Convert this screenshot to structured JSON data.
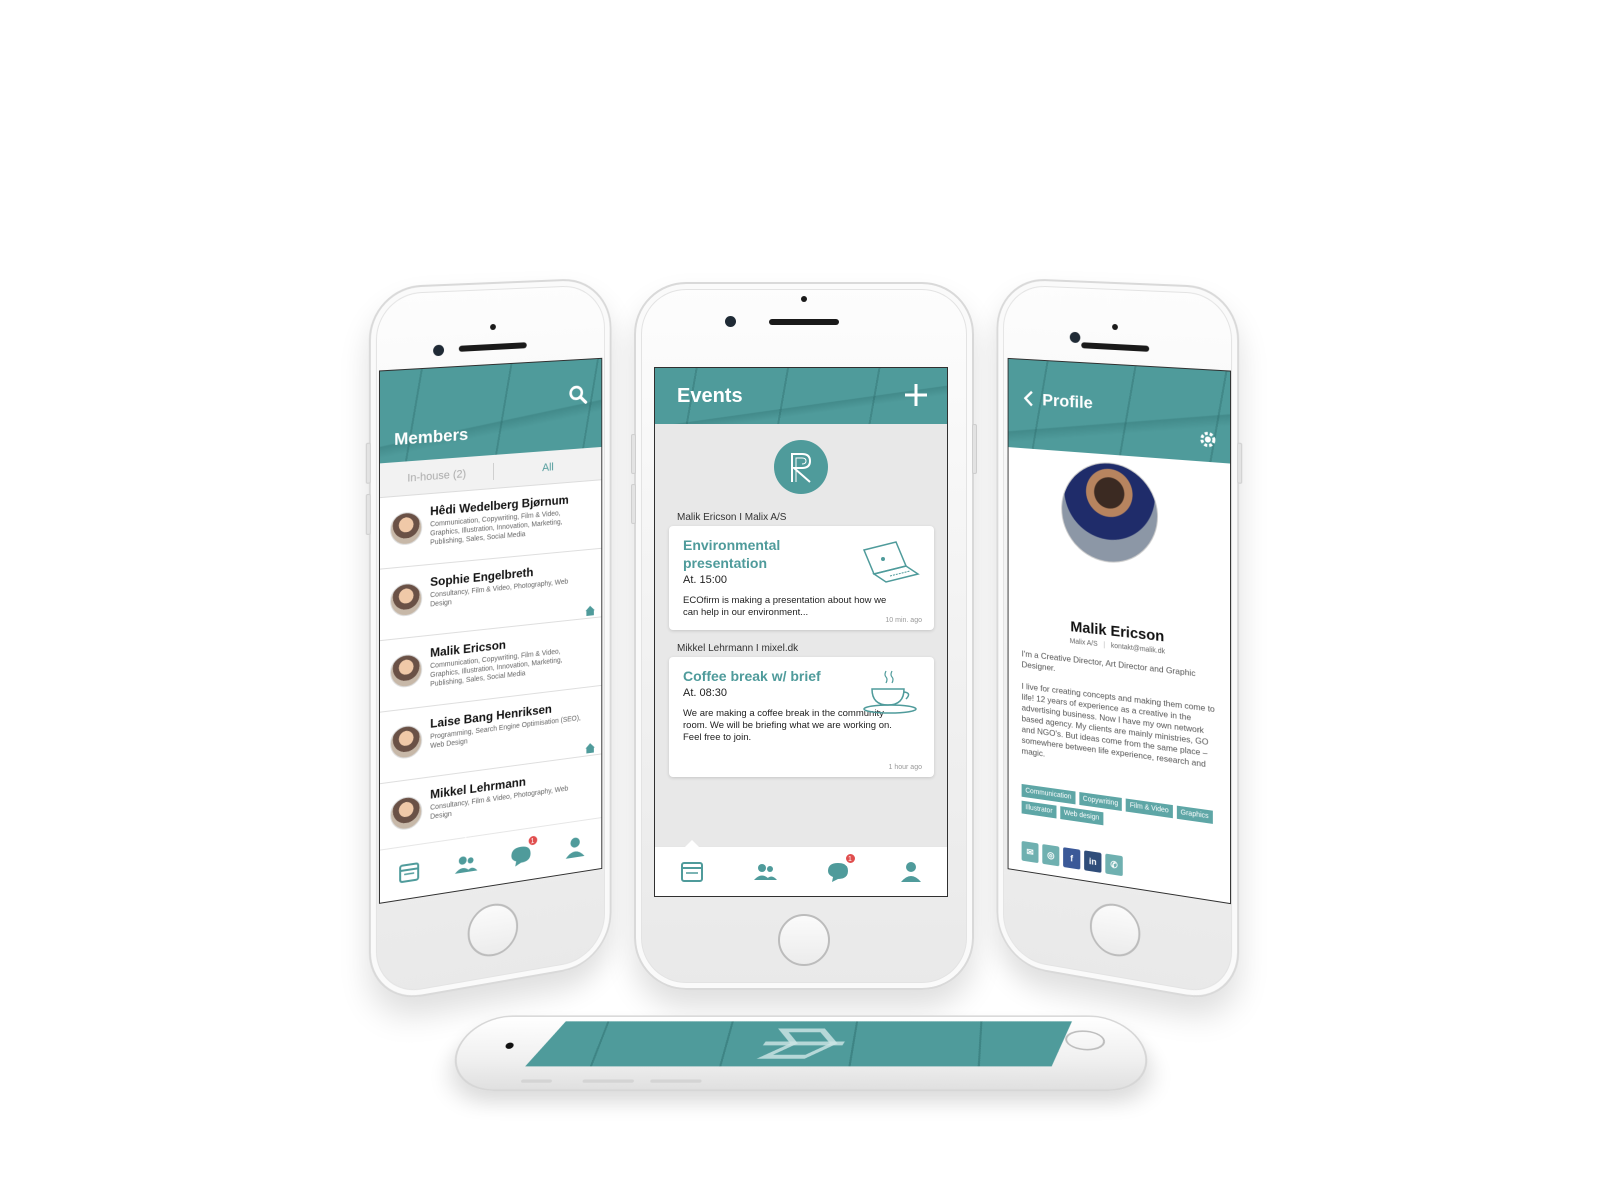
{
  "colors": {
    "accent": "#4f9b9b",
    "badge": "#e04e4e"
  },
  "members_screen": {
    "title": "Members",
    "segment_inhouse": "In-house (2)",
    "segment_all": "All",
    "members": [
      {
        "name": "Hêdi Wedelberg Bjørnum",
        "skills": "Communication, Copywriting, Film & Video, Graphics, Illustration, Innovation, Marketing, Publishing, Sales, Social Media",
        "in_house": false
      },
      {
        "name": "Sophie Engelbreth",
        "skills": "Consultancy, Film & Video, Photography, Web Design",
        "in_house": true
      },
      {
        "name": "Malik Ericson",
        "skills": "Communication, Copywriting, Film & Video, Graphics, Illustration, Innovation, Marketing, Publishing, Sales, Social Media",
        "in_house": false
      },
      {
        "name": "Laise Bang Henriksen",
        "skills": "Programming, Search Engine Optimisation (SEO), Web Design",
        "in_house": true
      },
      {
        "name": "Mikkel Lehrmann",
        "skills": "Consultancy, Film & Video, Photography, Web Design",
        "in_house": false
      }
    ],
    "chat_badge": "1"
  },
  "events_screen": {
    "title": "Events",
    "events": [
      {
        "author": "Malik Ericson  I  Malix A/S",
        "title": "Environmental presentation",
        "time": "At. 15:00",
        "desc": "ECOfirm is making a presentation about how we can help in our environment...",
        "ago": "10 min. ago",
        "icon": "laptop-icon"
      },
      {
        "author": "Mikkel Lehrmann  I  mixel.dk",
        "title": "Coffee break w/ brief",
        "time": "At. 08:30",
        "desc": "We are making a coffee break in the community room. We will be briefing what we are working on. Feel free to join.",
        "ago": "1 hour ago",
        "icon": "coffee-cup-icon"
      }
    ],
    "chat_badge": "1"
  },
  "profile_screen": {
    "title": "Profile",
    "name": "Malik Ericson",
    "company": "Malix A/S",
    "email": "kontakt@malik.dk",
    "bio_1": "I'm a Creative Director, Art Director and Graphic Designer.",
    "bio_2": "I live for creating concepts and making them come to life! 12 years of experience as a creative in the advertising business. Now I have my own network based agency. My clients are mainly ministries, GO and NGO's. But ideas come from the same place – somewhere between life experience, research and magic.",
    "tags": [
      "Communication",
      "Copywriting",
      "Film & Video",
      "Graphics",
      "Illustrator",
      "Web design"
    ],
    "socials": [
      {
        "name": "mail-icon",
        "color": "#6fb0b0",
        "glyph": "✉"
      },
      {
        "name": "dribbble-icon",
        "color": "#6fb0b0",
        "glyph": "◎"
      },
      {
        "name": "facebook-icon",
        "color": "#3b5998",
        "glyph": "f"
      },
      {
        "name": "linkedin-icon",
        "color": "#2f4d7a",
        "glyph": "in"
      },
      {
        "name": "phone-icon",
        "color": "#6fb0b0",
        "glyph": "✆"
      }
    ]
  }
}
